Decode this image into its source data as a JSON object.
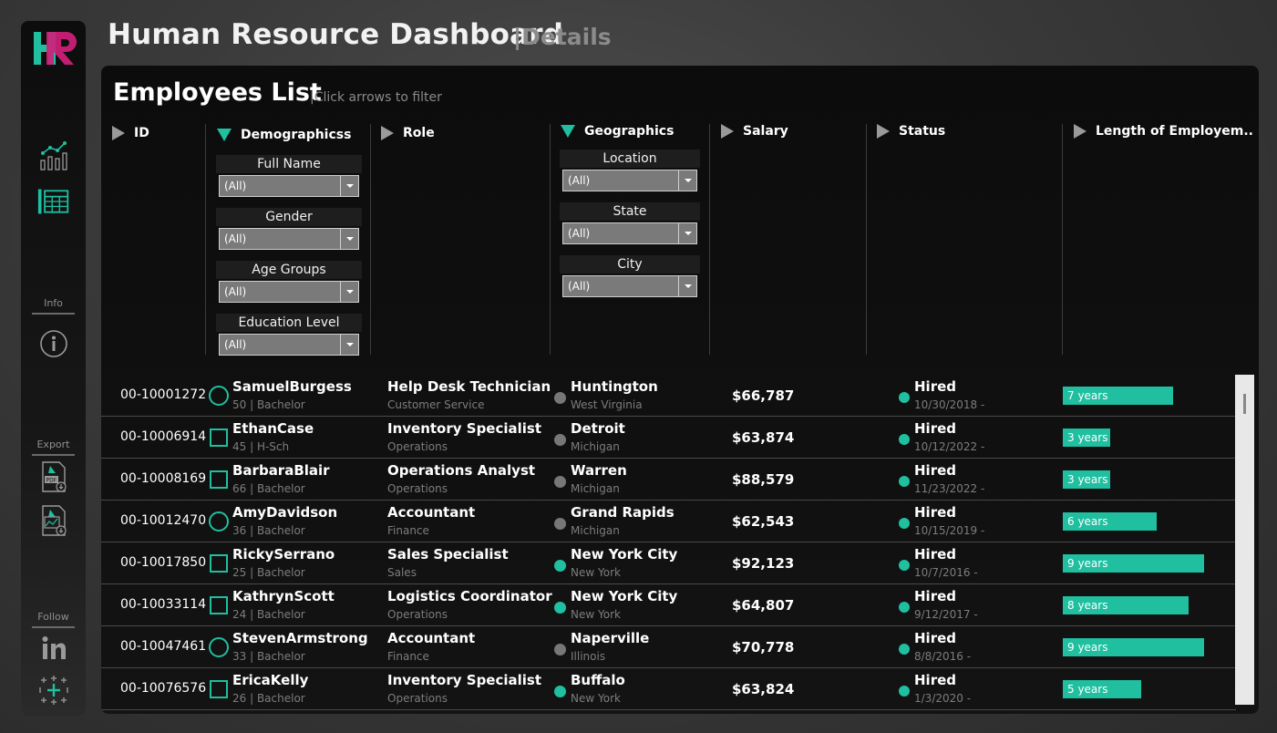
{
  "header": {
    "title": "Human Resource Dashboard",
    "subtitle": "|Details"
  },
  "sidebar": {
    "logo_text": "HR",
    "icons": [
      "chart-icon",
      "table-icon"
    ],
    "info_label": "Info",
    "export_label": "Export",
    "follow_label": "Follow"
  },
  "list": {
    "title": "Employees List",
    "hint": "|Click arrows to filter"
  },
  "columns": {
    "id": "ID",
    "demographics": "Demographicss",
    "role": "Role",
    "geographics": "Geographics",
    "salary": "Salary",
    "status": "Status",
    "length": "Length of Employem.."
  },
  "filters": {
    "demographics": [
      {
        "label": "Full Name",
        "value": "(All)"
      },
      {
        "label": "Gender",
        "value": "(All)"
      },
      {
        "label": "Age Groups",
        "value": "(All)"
      },
      {
        "label": "Education Level",
        "value": "(All)"
      }
    ],
    "geographics": [
      {
        "label": "Location",
        "value": "(All)"
      },
      {
        "label": "State",
        "value": "(All)"
      },
      {
        "label": "City",
        "value": "(All)"
      }
    ]
  },
  "colors": {
    "accent": "#1fbfa0",
    "gray_dot": "#777777"
  },
  "employees": [
    {
      "id": "00-10001272",
      "shape": "circle",
      "name": "SamuelBurgess",
      "details": "50 | Bachelor",
      "role": "Help Desk Technician",
      "department": "Customer Service",
      "hq": false,
      "city": "Huntington",
      "state": "West Virginia",
      "salary": "$66,787",
      "status": "Hired",
      "date": "10/30/2018 -",
      "length": "7 years",
      "years": 7
    },
    {
      "id": "00-10006914",
      "shape": "square",
      "name": "EthanCase",
      "details": "45 | H-Sch",
      "role": "Inventory Specialist",
      "department": "Operations",
      "hq": false,
      "city": "Detroit",
      "state": "Michigan",
      "salary": "$63,874",
      "status": "Hired",
      "date": "10/12/2022 -",
      "length": "3 years",
      "years": 3
    },
    {
      "id": "00-10008169",
      "shape": "square",
      "name": "BarbaraBlair",
      "details": "66 | Bachelor",
      "role": "Operations Analyst",
      "department": "Operations",
      "hq": false,
      "city": "Warren",
      "state": "Michigan",
      "salary": "$88,579",
      "status": "Hired",
      "date": "11/23/2022 -",
      "length": "3 years",
      "years": 3
    },
    {
      "id": "00-10012470",
      "shape": "circle",
      "name": "AmyDavidson",
      "details": "36 | Bachelor",
      "role": "Accountant",
      "department": "Finance",
      "hq": false,
      "city": "Grand Rapids",
      "state": "Michigan",
      "salary": "$62,543",
      "status": "Hired",
      "date": "10/15/2019 -",
      "length": "6 years",
      "years": 6
    },
    {
      "id": "00-10017850",
      "shape": "square",
      "name": "RickySerrano",
      "details": "25 | Bachelor",
      "role": "Sales Specialist",
      "department": "Sales",
      "hq": true,
      "city": "New York City",
      "state": "New York",
      "salary": "$92,123",
      "status": "Hired",
      "date": "10/7/2016 -",
      "length": "9 years",
      "years": 9
    },
    {
      "id": "00-10033114",
      "shape": "square",
      "name": "KathrynScott",
      "details": "24 | Bachelor",
      "role": "Logistics Coordinator",
      "department": "Operations",
      "hq": true,
      "city": "New York City",
      "state": "New York",
      "salary": "$64,807",
      "status": "Hired",
      "date": "9/12/2017 -",
      "length": "8 years",
      "years": 8
    },
    {
      "id": "00-10047461",
      "shape": "circle",
      "name": "StevenArmstrong",
      "details": "33 | Bachelor",
      "role": "Accountant",
      "department": "Finance",
      "hq": false,
      "city": "Naperville",
      "state": "Illinois",
      "salary": "$70,778",
      "status": "Hired",
      "date": "8/8/2016 -",
      "length": "9 years",
      "years": 9
    },
    {
      "id": "00-10076576",
      "shape": "square",
      "name": "EricaKelly",
      "details": "26 | Bachelor",
      "role": "Inventory Specialist",
      "department": "Operations",
      "hq": true,
      "city": "Buffalo",
      "state": "New York",
      "salary": "$63,824",
      "status": "Hired",
      "date": "1/3/2020 -",
      "length": "5 years",
      "years": 5
    }
  ]
}
